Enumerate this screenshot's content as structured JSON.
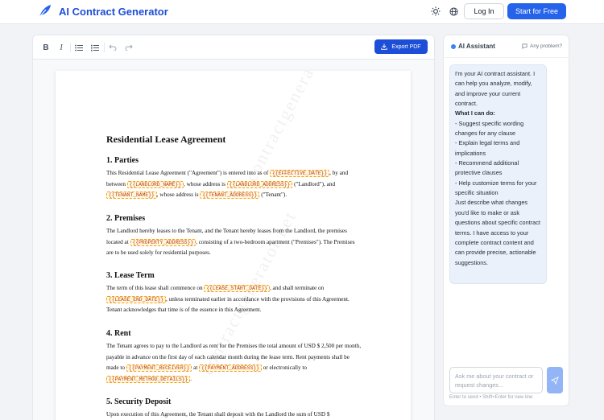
{
  "header": {
    "brand": "AI Contract Generator",
    "login_label": "Log In",
    "start_label": "Start for Free",
    "icons": [
      "feather-logo-icon",
      "sun-icon",
      "globe-icon"
    ]
  },
  "toolbar": {
    "bold_label": "B",
    "italic_label": "I",
    "export_label": "Export PDF"
  },
  "document": {
    "watermark": "contractgenerator.net",
    "title": "Residential Lease Agreement",
    "sections": [
      {
        "heading": "1. Parties",
        "t1": "This Residential Lease Agreement (\"Agreement\") is entered into as of ",
        "p1": "{{EFFECTIVE_DATE}}",
        "t2": ", by and between ",
        "p2": "{{LANDLORD_NAME}}",
        "t3": ", whose address is ",
        "p3": "{{LANDLORD_ADDRESS}}",
        "t4": " (\"Landlord\"), and ",
        "p4": "{{TENANT_NAME}}",
        "t5": ", whose address is ",
        "p5": "{{TENANT_ADDRESS}}",
        "t6": " (\"Tenant\")."
      },
      {
        "heading": "2. Premises",
        "t1": "The Landlord hereby leases to the Tenant, and the Tenant hereby leases from the Landlord, the premises located at ",
        "p1": "{{PROPERTY_ADDRESS}}",
        "t2": ", consisting of a two-bedroom apartment (\"Premises\"). The Premises are to be used solely for residential purposes."
      },
      {
        "heading": "3. Lease Term",
        "t1": "The term of this lease shall commence on ",
        "p1": "{{LEASE_START_DATE}}",
        "t2": ", and shall terminate on ",
        "p2": "{{LEASE_END_DATE}}",
        "t3": ", unless terminated earlier in accordance with the provisions of this Agreement. Tenant acknowledges that time is of the essence in this Agreement."
      },
      {
        "heading": "4. Rent",
        "t1": "The Tenant agrees to pay to the Landlord as rent for the Premises the total amount of USD $ 2,500 per month, payable in advance on the first day of each calendar month during the lease term. Rent payments shall be made to ",
        "p1": "{{PAYMENT_RECEIVER}}",
        "t2": " at ",
        "p2": "{{PAYMENT_ADDRESS}}",
        "t3": " or electronically to ",
        "p3": "{{PAYMENT_METHOD_DETAILS}}",
        "t4": "."
      },
      {
        "heading": "5. Security Deposit",
        "t1": "Upon execution of this Agreement, the Tenant shall deposit with the Landlord the sum of USD $"
      }
    ]
  },
  "assistant": {
    "title": "AI Assistant",
    "problem_label": "Any problem?",
    "message_intro": "I'm your AI contract assistant. I can help you analyze, modify, and improve your current contract.",
    "message_heading": "What I can do:",
    "message_items": [
      "- Suggest specific wording changes for any clause",
      "- Explain legal terms and implications",
      "- Recommend additional protective clauses",
      "- Help customize terms for your specific situation"
    ],
    "message_outro": "Just describe what changes you'd like to make or ask questions about specific contract terms. I have access to your complete contract content and can provide precise, actionable suggestions.",
    "input_placeholder": "Ask me about your contract or request changes...",
    "hint": "Enter to send • Shift+Enter for new line"
  }
}
